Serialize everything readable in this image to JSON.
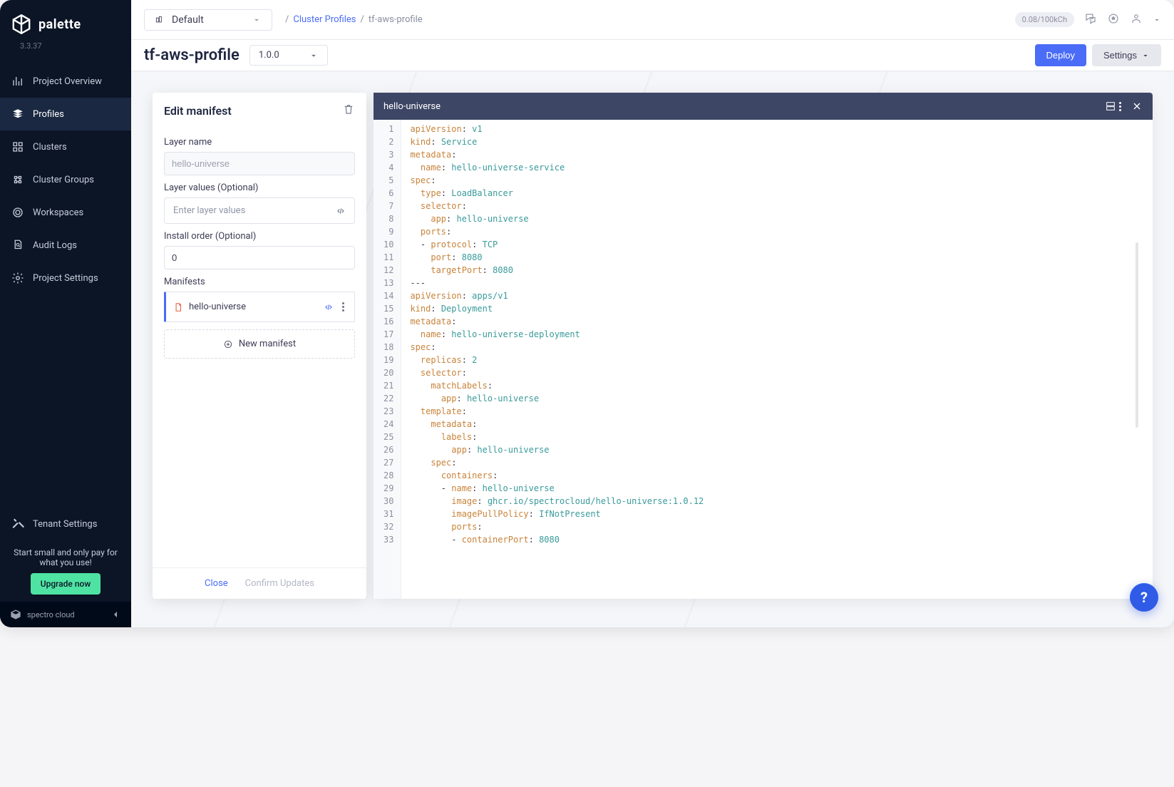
{
  "brand": {
    "name": "palette",
    "version": "3.3.37"
  },
  "sidebar": {
    "items": [
      {
        "label": "Project Overview",
        "icon": "chart"
      },
      {
        "label": "Profiles",
        "icon": "stack",
        "active": true
      },
      {
        "label": "Clusters",
        "icon": "grid"
      },
      {
        "label": "Cluster Groups",
        "icon": "groups"
      },
      {
        "label": "Workspaces",
        "icon": "target"
      },
      {
        "label": "Audit Logs",
        "icon": "search-doc"
      },
      {
        "label": "Project Settings",
        "icon": "gear"
      }
    ],
    "tenant_settings_label": "Tenant Settings",
    "upgrade_text": "Start small and only pay for what you use!",
    "upgrade_button": "Upgrade now",
    "footer": "spectro cloud"
  },
  "topbar": {
    "scope_label": "Default",
    "breadcrumb_link": "Cluster Profiles",
    "breadcrumb_current": "tf-aws-profile",
    "usage": "0.08/100kCh"
  },
  "titlebar": {
    "page_title": "tf-aws-profile",
    "version": "1.0.0",
    "deploy_button": "Deploy",
    "settings_button": "Settings"
  },
  "edit_panel": {
    "title": "Edit manifest",
    "layer_name_label": "Layer name",
    "layer_name_value": "hello-universe",
    "layer_values_label": "Layer values (Optional)",
    "layer_values_placeholder": "Enter layer values",
    "install_order_label": "Install order (Optional)",
    "install_order_value": "0",
    "manifests_label": "Manifests",
    "manifest_name": "hello-universe",
    "new_manifest_label": "New manifest",
    "close_button": "Close",
    "confirm_button": "Confirm Updates"
  },
  "editor": {
    "filename": "hello-universe",
    "lines": [
      {
        "n": 1,
        "tokens": [
          [
            "k",
            "apiVersion"
          ],
          [
            "p",
            ": "
          ],
          [
            "v",
            "v1"
          ]
        ]
      },
      {
        "n": 2,
        "tokens": [
          [
            "k",
            "kind"
          ],
          [
            "p",
            ": "
          ],
          [
            "v",
            "Service"
          ]
        ]
      },
      {
        "n": 3,
        "tokens": [
          [
            "k",
            "metadata"
          ],
          [
            "p",
            ":"
          ]
        ]
      },
      {
        "n": 4,
        "tokens": [
          [
            "p",
            "  "
          ],
          [
            "k",
            "name"
          ],
          [
            "p",
            ": "
          ],
          [
            "v",
            "hello-universe-service"
          ]
        ]
      },
      {
        "n": 5,
        "tokens": [
          [
            "k",
            "spec"
          ],
          [
            "p",
            ":"
          ]
        ]
      },
      {
        "n": 6,
        "tokens": [
          [
            "p",
            "  "
          ],
          [
            "k",
            "type"
          ],
          [
            "p",
            ": "
          ],
          [
            "v",
            "LoadBalancer"
          ]
        ]
      },
      {
        "n": 7,
        "tokens": [
          [
            "p",
            "  "
          ],
          [
            "k",
            "selector"
          ],
          [
            "p",
            ":"
          ]
        ]
      },
      {
        "n": 8,
        "tokens": [
          [
            "p",
            "    "
          ],
          [
            "k",
            "app"
          ],
          [
            "p",
            ": "
          ],
          [
            "v",
            "hello-universe"
          ]
        ]
      },
      {
        "n": 9,
        "tokens": [
          [
            "p",
            "  "
          ],
          [
            "k",
            "ports"
          ],
          [
            "p",
            ":"
          ]
        ]
      },
      {
        "n": 10,
        "tokens": [
          [
            "p",
            "  - "
          ],
          [
            "k",
            "protocol"
          ],
          [
            "p",
            ": "
          ],
          [
            "v",
            "TCP"
          ]
        ]
      },
      {
        "n": 11,
        "tokens": [
          [
            "p",
            "    "
          ],
          [
            "k",
            "port"
          ],
          [
            "p",
            ": "
          ],
          [
            "n",
            "8080"
          ]
        ]
      },
      {
        "n": 12,
        "tokens": [
          [
            "p",
            "    "
          ],
          [
            "k",
            "targetPort"
          ],
          [
            "p",
            ": "
          ],
          [
            "n",
            "8080"
          ]
        ]
      },
      {
        "n": 13,
        "tokens": [
          [
            "p",
            "---"
          ]
        ]
      },
      {
        "n": 14,
        "tokens": [
          [
            "k",
            "apiVersion"
          ],
          [
            "p",
            ": "
          ],
          [
            "v",
            "apps/v1"
          ]
        ]
      },
      {
        "n": 15,
        "tokens": [
          [
            "k",
            "kind"
          ],
          [
            "p",
            ": "
          ],
          [
            "v",
            "Deployment"
          ]
        ]
      },
      {
        "n": 16,
        "tokens": [
          [
            "k",
            "metadata"
          ],
          [
            "p",
            ":"
          ]
        ]
      },
      {
        "n": 17,
        "tokens": [
          [
            "p",
            "  "
          ],
          [
            "k",
            "name"
          ],
          [
            "p",
            ": "
          ],
          [
            "v",
            "hello-universe-deployment"
          ]
        ]
      },
      {
        "n": 18,
        "tokens": [
          [
            "k",
            "spec"
          ],
          [
            "p",
            ":"
          ]
        ]
      },
      {
        "n": 19,
        "tokens": [
          [
            "p",
            "  "
          ],
          [
            "k",
            "replicas"
          ],
          [
            "p",
            ": "
          ],
          [
            "n",
            "2"
          ]
        ]
      },
      {
        "n": 20,
        "tokens": [
          [
            "p",
            "  "
          ],
          [
            "k",
            "selector"
          ],
          [
            "p",
            ":"
          ]
        ]
      },
      {
        "n": 21,
        "tokens": [
          [
            "p",
            "    "
          ],
          [
            "k",
            "matchLabels"
          ],
          [
            "p",
            ":"
          ]
        ]
      },
      {
        "n": 22,
        "tokens": [
          [
            "p",
            "      "
          ],
          [
            "k",
            "app"
          ],
          [
            "p",
            ": "
          ],
          [
            "v",
            "hello-universe"
          ]
        ]
      },
      {
        "n": 23,
        "tokens": [
          [
            "p",
            "  "
          ],
          [
            "k",
            "template"
          ],
          [
            "p",
            ":"
          ]
        ]
      },
      {
        "n": 24,
        "tokens": [
          [
            "p",
            "    "
          ],
          [
            "k",
            "metadata"
          ],
          [
            "p",
            ":"
          ]
        ]
      },
      {
        "n": 25,
        "tokens": [
          [
            "p",
            "      "
          ],
          [
            "k",
            "labels"
          ],
          [
            "p",
            ":"
          ]
        ]
      },
      {
        "n": 26,
        "tokens": [
          [
            "p",
            "        "
          ],
          [
            "k",
            "app"
          ],
          [
            "p",
            ": "
          ],
          [
            "v",
            "hello-universe"
          ]
        ]
      },
      {
        "n": 27,
        "tokens": [
          [
            "p",
            "    "
          ],
          [
            "k",
            "spec"
          ],
          [
            "p",
            ":"
          ]
        ]
      },
      {
        "n": 28,
        "tokens": [
          [
            "p",
            "      "
          ],
          [
            "k",
            "containers"
          ],
          [
            "p",
            ":"
          ]
        ]
      },
      {
        "n": 29,
        "tokens": [
          [
            "p",
            "      - "
          ],
          [
            "k",
            "name"
          ],
          [
            "p",
            ": "
          ],
          [
            "v",
            "hello-universe"
          ]
        ]
      },
      {
        "n": 30,
        "tokens": [
          [
            "p",
            "        "
          ],
          [
            "k",
            "image"
          ],
          [
            "p",
            ": "
          ],
          [
            "v",
            "ghcr.io/spectrocloud/hello-universe:1.0.12"
          ]
        ]
      },
      {
        "n": 31,
        "tokens": [
          [
            "p",
            "        "
          ],
          [
            "k",
            "imagePullPolicy"
          ],
          [
            "p",
            ": "
          ],
          [
            "v",
            "IfNotPresent"
          ]
        ]
      },
      {
        "n": 32,
        "tokens": [
          [
            "p",
            "        "
          ],
          [
            "k",
            "ports"
          ],
          [
            "p",
            ":"
          ]
        ]
      },
      {
        "n": 33,
        "tokens": [
          [
            "p",
            "        - "
          ],
          [
            "k",
            "containerPort"
          ],
          [
            "p",
            ": "
          ],
          [
            "n",
            "8080"
          ]
        ]
      }
    ]
  },
  "help_fab": "?"
}
